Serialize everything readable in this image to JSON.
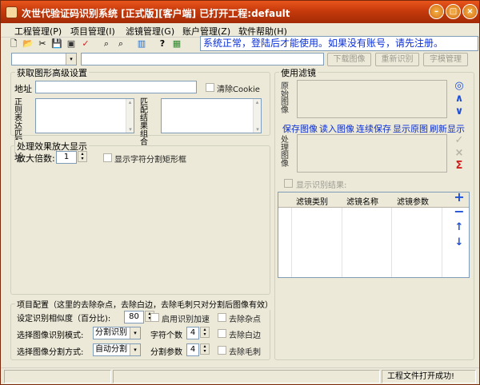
{
  "window": {
    "title": "次世代验证码识别系统 [正式版][客户端] 已打开工程:default",
    "min_symbol": "–",
    "max_symbol": "□",
    "close_symbol": "×"
  },
  "menu": [
    "工程管理(P)",
    "项目管理(I)",
    "滤镜管理(G)",
    "账户管理(Z)",
    "软件帮助(H)"
  ],
  "toolbar": {
    "icons": [
      "new-file-icon",
      "open-folder-icon",
      "cut-icon",
      "save-icon",
      "save-as-icon",
      "check-icon",
      "find-icon",
      "find-next-icon",
      "chart-icon",
      "help-pointer-icon",
      "image-icon"
    ],
    "glyphs": [
      "🗋",
      "📂",
      "✂",
      "💾",
      "▣",
      "✓",
      "⌕",
      "⌕",
      "▥",
      "?",
      "▦"
    ],
    "status_message": "系统正常，登陆后才能使用。如果没有账号，请先注册。"
  },
  "row2": {
    "combo_arrow": "▾",
    "download_button": "下载图像",
    "recognize_button": "重新识别",
    "charset_button": "字模管理"
  },
  "advanced": {
    "group_title": "获取图形高级设置",
    "address_label": "地址",
    "clear_cookie_label": "清除Cookie",
    "regex_label": "正则表达匹配网址",
    "match_label": "匹配结果组合",
    "scroll_up": "▴",
    "scroll_down": "▾"
  },
  "zoom": {
    "group_title": "处理效果放大显示",
    "factor_label": "放大倍数:",
    "factor_value": "1",
    "show_char_box_label": "显示字符分割矩形框"
  },
  "project": {
    "group_title": "项目配置（这里的去除杂点，去除白边，去除毛刺只对分割后图像有效）",
    "similarity_label": "设定识别相似度（百分比):",
    "similarity_value": "80",
    "speedup_label": "启用识别加速",
    "remove_noise_label": "去除杂点",
    "mode_label": "选择图像识别模式:",
    "mode_value": "分割识别",
    "char_count_label": "字符个数",
    "char_count_value": "4",
    "remove_border_label": "去除白边",
    "split_label": "选择图像分割方式:",
    "split_value": "自动分割",
    "split_param_label": "分割参数",
    "split_param_value": "4",
    "remove_burr_label": "去除毛刺"
  },
  "filter": {
    "group_title": "使用滤镜",
    "original_label": "原始图像",
    "processed_label": "处理图像",
    "links": [
      "保存图像",
      "读入图像",
      "连续保存",
      "显示原图",
      "刷新显示"
    ],
    "show_result_label": "显示识别结果:",
    "side_icons_top": [
      "◎",
      "∧",
      "∨"
    ],
    "side_icons_mid": [
      "✓",
      "×",
      "Σ"
    ],
    "side_icons_bottom": [
      "+",
      "−",
      "↑",
      "↓"
    ],
    "table_headers": [
      "滤镜类别",
      "滤镜名称",
      "滤镜参数"
    ]
  },
  "status": {
    "message": "工程文件打开成功!"
  }
}
